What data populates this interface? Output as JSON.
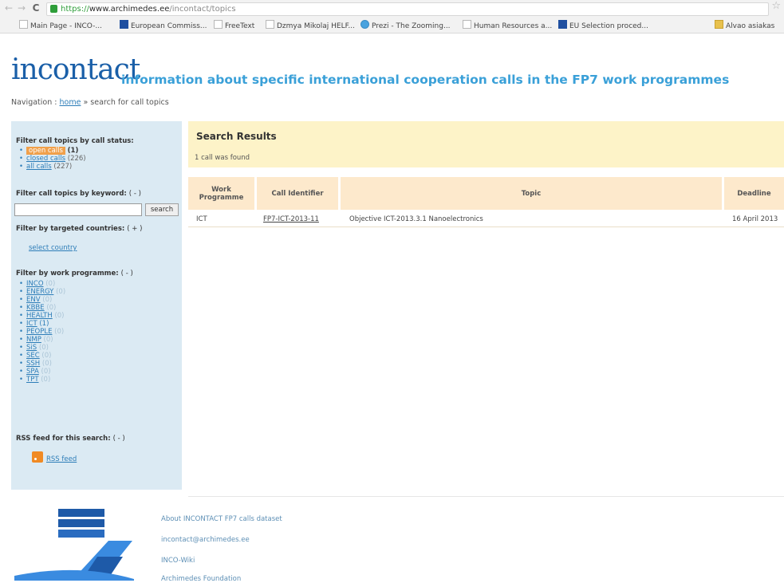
{
  "browser": {
    "url_scheme": "https://",
    "url_host": "www.archimedes.ee",
    "url_path": "/incontact/topics",
    "bookmarks": [
      "Main Page - INCO-...",
      "European Commiss...",
      "FreeText",
      "Dzmya Mikolaj HELF...",
      "Prezi - The Zooming...",
      "Human Resources a...",
      "EU Selection proced...",
      "Alvao asiakas"
    ]
  },
  "header": {
    "logo": "incontact",
    "tagline": "information about specific international cooperation calls in the FP7 work programmes",
    "nav_label": "Navigation :",
    "nav_home": "home",
    "nav_current": "» search for call topics"
  },
  "sidebar": {
    "status_heading": "Filter call topics by call status:",
    "status_items": [
      {
        "label": "open calls",
        "count": "(1)"
      },
      {
        "label": "closed calls",
        "count": "(226)"
      },
      {
        "label": "all calls",
        "count": "(227)"
      }
    ],
    "keyword_heading": "Filter call topics by keyword:",
    "keyword_toggle": "( - )",
    "keyword_value": "",
    "search_button": "search",
    "countries_heading": "Filter by targeted countries:",
    "countries_toggle": "( + )",
    "select_country": "select country",
    "programme_heading": "Filter by work programme:",
    "programme_toggle": "( - )",
    "programmes": [
      {
        "label": "INCO",
        "count": "(0)"
      },
      {
        "label": "ENERGY",
        "count": "(0)"
      },
      {
        "label": "ENV",
        "count": "(0)"
      },
      {
        "label": "KBBE",
        "count": "(0)"
      },
      {
        "label": "HEALTH",
        "count": "(0)"
      },
      {
        "label": "ICT",
        "count": "(1)"
      },
      {
        "label": "PEOPLE",
        "count": "(0)"
      },
      {
        "label": "NMP",
        "count": "(0)"
      },
      {
        "label": "SiS",
        "count": "(0)"
      },
      {
        "label": "SEC",
        "count": "(0)"
      },
      {
        "label": "SSH",
        "count": "(0)"
      },
      {
        "label": "SPA",
        "count": "(0)"
      },
      {
        "label": "TPT",
        "count": "(0)"
      }
    ],
    "rss_heading": "RSS feed for this search:",
    "rss_toggle": "( - )",
    "rss_label": "RSS feed"
  },
  "results": {
    "title": "Search Results",
    "summary": "1 call was found",
    "columns": [
      "Work Programme",
      "Call Identifier",
      "Topic",
      "Deadline"
    ],
    "rows": [
      {
        "programme": "ICT",
        "call_id": "FP7-ICT-2013-11",
        "topic": "Objective ICT-2013.3.1 Nanoelectronics",
        "deadline": "16 April 2013"
      }
    ]
  },
  "footer": {
    "links": [
      "About INCONTACT FP7 calls dataset",
      "incontact@archimedes.ee",
      "INCO-Wiki",
      "Archimedes Foundation"
    ]
  },
  "colors": {
    "brand_blue": "#1a5fa8",
    "tagline_blue": "#3aa0d8",
    "sidebar_bg": "#dbeaf3",
    "results_bg": "#fdf3c8",
    "header_row_bg": "#fde9cc",
    "highlight_orange": "#f0a04b"
  }
}
